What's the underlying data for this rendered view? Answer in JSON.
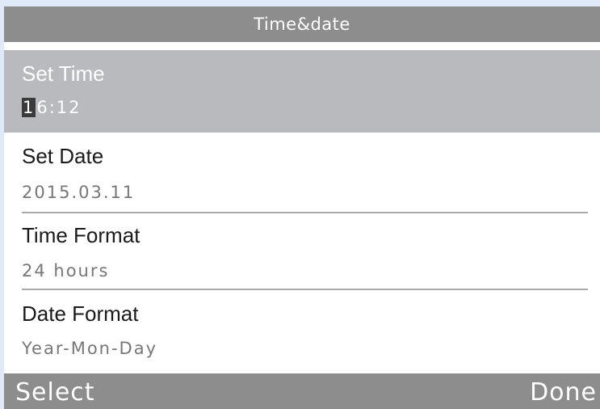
{
  "header": {
    "title": "Time&date"
  },
  "settings": {
    "items": [
      {
        "label": "Set Time",
        "cursor_char": "1",
        "value_rest": "6:12",
        "selected": true
      },
      {
        "label": "Set Date",
        "value": "2015.03.11"
      },
      {
        "label": "Time Format",
        "value": "24 hours"
      },
      {
        "label": "Date Format",
        "value": "Year-Mon-Day"
      }
    ]
  },
  "softkeys": {
    "left_label": "Select",
    "right_label": "Done"
  },
  "colors": {
    "bar_gray": "#8d8d8d",
    "selected_row": "#b9babd",
    "frame_blue": "#dfe9f7"
  }
}
